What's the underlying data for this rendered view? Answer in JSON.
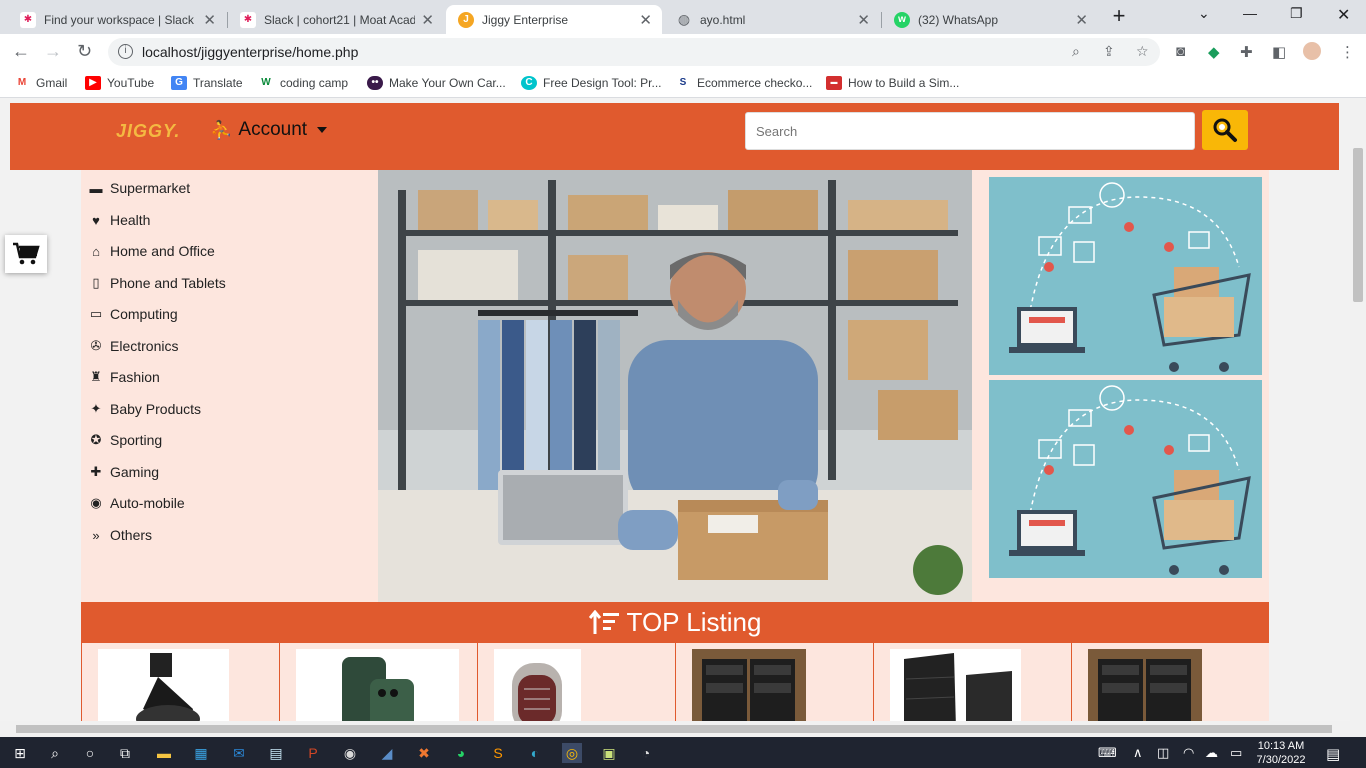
{
  "browser": {
    "tabs": [
      {
        "title": "Find your workspace | Slack",
        "icon": "slack-icon",
        "active": false
      },
      {
        "title": "Slack | cohort21 | Moat Acad",
        "icon": "slack-icon",
        "active": false
      },
      {
        "title": "Jiggy Enterprise",
        "icon": "jiggy-icon",
        "active": true
      },
      {
        "title": "ayo.html",
        "icon": "globe-icon",
        "active": false
      },
      {
        "title": "(32) WhatsApp",
        "icon": "whatsapp-icon",
        "active": false
      }
    ],
    "address": "localhost/jiggyenterprise/home.php",
    "bookmarks": [
      {
        "label": "Gmail",
        "icon": "gmail-icon"
      },
      {
        "label": "YouTube",
        "icon": "youtube-icon"
      },
      {
        "label": "Translate",
        "icon": "translate-icon"
      },
      {
        "label": "coding camp",
        "icon": "w-icon"
      },
      {
        "label": "Make Your Own Car...",
        "icon": "dots-icon"
      },
      {
        "label": "Free Design Tool: Pr...",
        "icon": "canva-icon"
      },
      {
        "label": "Ecommerce checko...",
        "icon": "s-icon"
      },
      {
        "label": "How to Build a Sim...",
        "icon": "red-icon"
      }
    ]
  },
  "site": {
    "logo": "JIGGY.",
    "account_label": "Account",
    "search_placeholder": "Search",
    "categories": [
      {
        "label": "Supermarket",
        "icon": "store-icon",
        "glyph": "▬"
      },
      {
        "label": "Health",
        "icon": "heartbeat-icon",
        "glyph": "♥"
      },
      {
        "label": "Home and Office",
        "icon": "home-icon",
        "glyph": "⌂"
      },
      {
        "label": "Phone and Tablets",
        "icon": "phone-icon",
        "glyph": "▯"
      },
      {
        "label": "Computing",
        "icon": "desktop-icon",
        "glyph": "▭"
      },
      {
        "label": "Electronics",
        "icon": "plug-icon",
        "glyph": "✇"
      },
      {
        "label": "Fashion",
        "icon": "tshirt-icon",
        "glyph": "♜"
      },
      {
        "label": "Baby Products",
        "icon": "baby-icon",
        "glyph": "✦"
      },
      {
        "label": "Sporting",
        "icon": "football-icon",
        "glyph": "✪"
      },
      {
        "label": "Gaming",
        "icon": "puzzle-icon",
        "glyph": "✚"
      },
      {
        "label": "Auto-mobile",
        "icon": "steering-icon",
        "glyph": "◉"
      },
      {
        "label": "Others",
        "icon": "double-chevron-icon",
        "glyph": "»"
      }
    ],
    "top_listing_title": "TOP Listing",
    "accent": "#e05a2e",
    "accent_light": "#fde6de",
    "button_yellow": "#f9b707"
  },
  "taskbar": {
    "time": "10:13 AM",
    "date": "7/30/2022"
  }
}
